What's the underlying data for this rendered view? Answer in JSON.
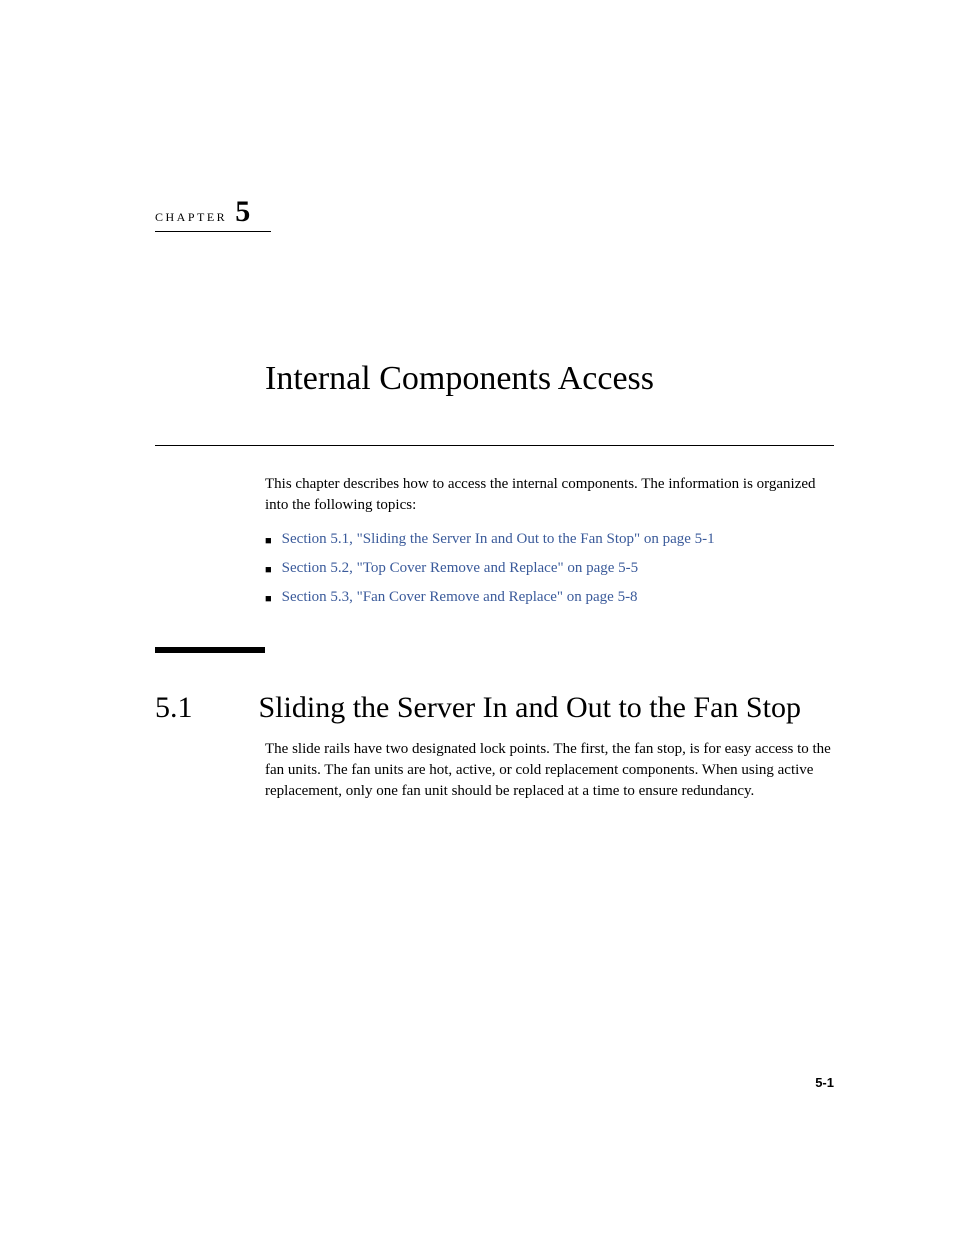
{
  "chapter": {
    "label": "CHAPTER",
    "number": "5",
    "title": "Internal Components Access"
  },
  "intro": "This chapter describes how to access the internal components. The information is organized into the following topics:",
  "links": [
    "Section 5.1, \"Sliding the Server In and Out to the Fan Stop\" on page 5-1",
    "Section 5.2, \"Top Cover Remove and Replace\" on page 5-5",
    "Section 5.3, \"Fan Cover Remove and Replace\" on page 5-8"
  ],
  "section": {
    "number": "5.1",
    "title": "Sliding the Server In and Out to the Fan Stop",
    "body": "The slide rails have two designated lock points. The first, the fan stop, is for easy access to the fan units. The fan units are hot, active, or cold replacement components. When using active replacement, only one fan unit should be replaced at a time to ensure redundancy."
  },
  "pageNumber": "5-1"
}
